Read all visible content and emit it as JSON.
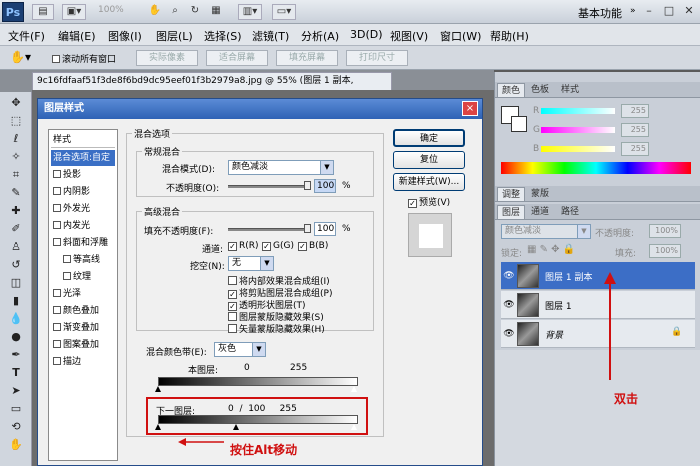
{
  "appbar": {
    "logo": "Ps",
    "zoom": "100%",
    "workspace": "基本功能"
  },
  "menu": [
    "文件(F)",
    "编辑(E)",
    "图像(I)",
    "图层(L)",
    "选择(S)",
    "滤镜(T)",
    "分析(A)",
    "3D(D)",
    "视图(V)",
    "窗口(W)",
    "帮助(H)"
  ],
  "options": {
    "scroll_all": "滚动所有窗口",
    "btn_actual": "实际像素",
    "btn_fit": "适合屏幕",
    "btn_fill": "填充屏幕",
    "btn_print": "打印尺寸"
  },
  "document": {
    "tab": "9c16fdfaaf51f3de8f6bd9dc95eef01f3b2979a8.jpg @ 55% (图层 1 副本, RGB/8#)",
    "close": "×"
  },
  "panels": {
    "color_tabs": [
      "颜色",
      "色板",
      "样式"
    ],
    "rgb": [
      {
        "c": "R",
        "v": "255"
      },
      {
        "c": "G",
        "v": "255"
      },
      {
        "c": "B",
        "v": "255"
      }
    ],
    "adjust_tabs": [
      "调整",
      "蒙版"
    ],
    "layer_tabs": [
      "图层",
      "通道",
      "路径"
    ],
    "blend": "颜色减淡",
    "opacity_label": "不透明度:",
    "opacity": "100%",
    "lock_label": "锁定:",
    "fill_label": "填充:",
    "fill": "100%",
    "layers": [
      "图层 1 副本",
      "图层 1",
      "背景"
    ]
  },
  "dialog": {
    "title": "图层样式",
    "close": "×",
    "styles": [
      "样式",
      "混合选项:自定",
      "投影",
      "内阴影",
      "外发光",
      "内发光",
      "斜面和浮雕",
      "等高线",
      "纹理",
      "光泽",
      "颜色叠加",
      "渐变叠加",
      "图案叠加",
      "描边"
    ],
    "blend_options": "混合选项",
    "general": "常规混合",
    "mode_label": "混合模式(D):",
    "mode": "颜色减淡",
    "opacity_label": "不透明度(O):",
    "opacity": "100",
    "pct": "%",
    "advanced": "高级混合",
    "fill_label": "填充不透明度(F):",
    "fill": "100",
    "channels_label": "通道:",
    "ch": [
      "R(R)",
      "G(G)",
      "B(B)"
    ],
    "knockout_label": "挖空(N):",
    "knockout": "无",
    "checks": [
      "将内部效果混合成组(I)",
      "将剪贴图层混合成组(P)",
      "透明形状图层(T)",
      "图层蒙版隐藏效果(S)",
      "矢量蒙版隐藏效果(H)"
    ],
    "blendif_label": "混合颜色带(E):",
    "blendif": "灰色",
    "this_layer": "本图层:",
    "this_l": "0",
    "this_r": "255",
    "under_layer": "下一图层:",
    "under_vals": "0  /  100     255",
    "btn_ok": "确定",
    "btn_reset": "复位",
    "btn_new": "新建样式(W)...",
    "preview": "预览(V)"
  },
  "annotations": {
    "double_click": "双击",
    "alt_drag": "按住Alt移动"
  }
}
